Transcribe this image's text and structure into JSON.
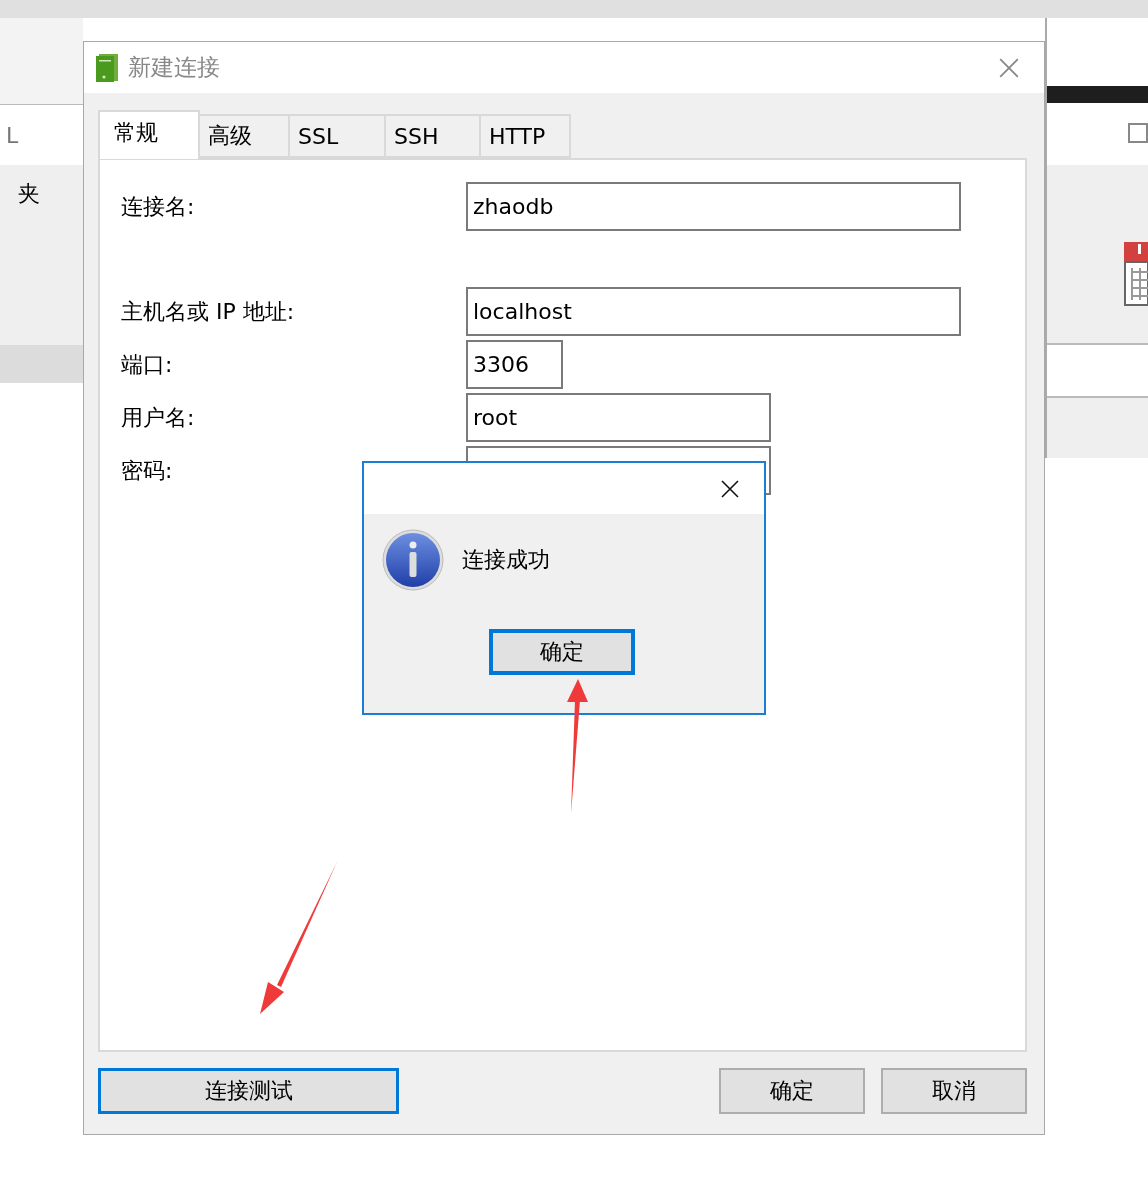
{
  "background": {
    "left_items": [
      "L",
      "夹"
    ]
  },
  "dialog": {
    "title": "新建连接",
    "tabs": [
      {
        "label": "常规",
        "selected": true
      },
      {
        "label": "高级",
        "selected": false
      },
      {
        "label": "SSL",
        "selected": false
      },
      {
        "label": "SSH",
        "selected": false
      },
      {
        "label": "HTTP",
        "selected": false
      }
    ],
    "fields": [
      {
        "label": "连接名:",
        "value": "zhaodb"
      },
      {
        "label": "主机名或 IP 地址:",
        "value": "localhost"
      },
      {
        "label": "端口:",
        "value": "3306"
      },
      {
        "label": "用户名:",
        "value": "root"
      },
      {
        "label": "密码:"
      }
    ],
    "buttons": [
      {
        "label": "连接测试",
        "focused": true
      },
      {
        "label": "确定",
        "focused": false
      },
      {
        "label": "取消",
        "focused": false
      }
    ]
  },
  "message_box": {
    "text": "连接成功",
    "button": {
      "label": "确定",
      "focused": true
    }
  }
}
